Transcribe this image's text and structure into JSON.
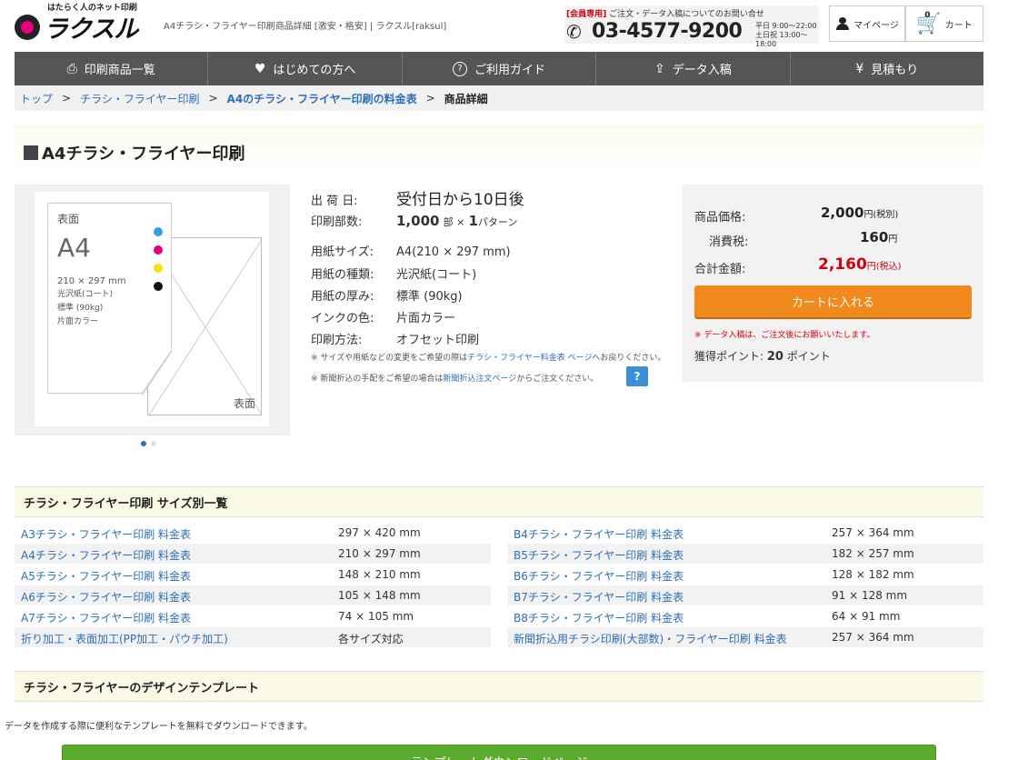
{
  "header": {
    "logo_tagline": "はたらく人のネット印刷",
    "logo_text": "ラクスル",
    "page_desc": "A4チラシ・フライヤー印刷商品詳細 [激安・格安] | ラクスル[raksul]",
    "contact_member": "[会員専用]",
    "contact_text": "ご注文・データ入稿についてのお問い合せ",
    "contact_phone": "03-4577-9200",
    "hours_weekday": "平日 9:00〜22:00",
    "hours_weekend": "土日祝 13:00〜18:00",
    "mypage_label": "マイページ",
    "cart_label": "カート",
    "cart_count": "0"
  },
  "nav": [
    {
      "label": "印刷商品一覧",
      "icon": "printer-icon",
      "glyph": "⎙"
    },
    {
      "label": "はじめての方へ",
      "icon": "heart-icon",
      "glyph": "♥"
    },
    {
      "label": "ご利用ガイド",
      "icon": "question-icon",
      "glyph": "?"
    },
    {
      "label": "データ入稿",
      "icon": "upload-icon",
      "glyph": "⇪"
    },
    {
      "label": "見積もり",
      "icon": "yen-icon",
      "glyph": "¥"
    }
  ],
  "breadcrumb": {
    "home": "トップ",
    "cat": "チラシ・フライヤー印刷",
    "price": "A4のチラシ・フライヤー印刷の料金表",
    "current": "商品詳細",
    "sep": ">"
  },
  "page_title": "A4チラシ・フライヤー印刷",
  "preview": {
    "front_label": "表面",
    "size": "A4",
    "dims": "210 × 297 mm",
    "paper": "光沢紙(コート)",
    "thickness": "標準 (90kg)",
    "color": "片面カラー",
    "back_label": "表面",
    "dot_colors": [
      "#2ea3e0",
      "#e5007f",
      "#f7e400",
      "#111111"
    ]
  },
  "specs": {
    "ship_label": "出 荷 日:",
    "ship_val": "受付日から10日後",
    "count_label": "印刷部数:",
    "count_num": "1,000",
    "count_unit": "部 ×",
    "pattern_num": "1",
    "pattern_unit": "パターン",
    "size_label": "用紙サイズ:",
    "size_val": "A4(210 × 297 mm)",
    "type_label": "用紙の種類:",
    "type_val": "光沢紙(コート)",
    "thick_label": "用紙の厚み:",
    "thick_val": "標準 (90kg)",
    "ink_label": "インクの色:",
    "ink_val": "片面カラー",
    "method_label": "印刷方法:",
    "method_val": "オフセット印刷",
    "note1_pre": "※ サイズや用紙などの変更をご希望の際は",
    "note1_link": "チラシ・フライヤー料金表 ページ",
    "note1_post": "へお戻りください。",
    "note2_pre": "※ 新聞折込の手配をご希望の場合は",
    "note2_link": "新聞折込注文ページ",
    "note2_post": "からご注文ください。",
    "help": "?"
  },
  "price": {
    "price_label": "商品価格:",
    "price_val": "2,000",
    "price_unit": "円(税別)",
    "tax_label": "消費税:",
    "tax_val": "160",
    "tax_unit": "円",
    "total_label": "合計金額:",
    "total_val": "2,160",
    "total_unit": "円(税込)",
    "cart_button": "カートに入れる",
    "upload_note": "※ データ入稿は、ご注文後にお願いいたします。",
    "points_label": "獲得ポイント:",
    "points_val": "20",
    "points_unit": "ポイント"
  },
  "size_section": {
    "title": "チラシ・フライヤー印刷 サイズ別一覧",
    "rows": [
      {
        "l_name": "A3チラシ・フライヤー印刷 料金表",
        "l_dim": "297 × 420 mm",
        "r_name": "B4チラシ・フライヤー印刷 料金表",
        "r_dim": "257 × 364 mm"
      },
      {
        "l_name": "A4チラシ・フライヤー印刷 料金表",
        "l_dim": "210 × 297 mm",
        "r_name": "B5チラシ・フライヤー印刷 料金表",
        "r_dim": "182 × 257 mm"
      },
      {
        "l_name": "A5チラシ・フライヤー印刷 料金表",
        "l_dim": "148 × 210 mm",
        "r_name": "B6チラシ・フライヤー印刷 料金表",
        "r_dim": "128 × 182 mm"
      },
      {
        "l_name": "A6チラシ・フライヤー印刷 料金表",
        "l_dim": "105 × 148 mm",
        "r_name": "B7チラシ・フライヤー印刷 料金表",
        "r_dim": "91 × 128 mm"
      },
      {
        "l_name": "A7チラシ・フライヤー印刷 料金表",
        "l_dim": "74 × 105 mm",
        "r_name": "B8チラシ・フライヤー印刷 料金表",
        "r_dim": "64 × 91 mm"
      },
      {
        "l_name": "折り加工・表面加工(PP加工・パウチ加工)",
        "l_dim": "各サイズ対応",
        "r_name": "新聞折込用チラシ印刷(大部数)・フライヤー印刷 料金表",
        "r_dim": "257 × 364 mm"
      }
    ]
  },
  "template_section": {
    "title": "チラシ・フライヤーのデザインテンプレート",
    "desc": "データを作成する際に便利なテンプレートを無料でダウンロードできます。",
    "button": "テンプレートダウンロードページ"
  },
  "colors": {
    "accent_orange": "#f18a1c",
    "link_blue": "#2a6fb7",
    "price_red": "#d4000d",
    "nav_gray": "#555555",
    "green_button": "#5dab2d"
  }
}
